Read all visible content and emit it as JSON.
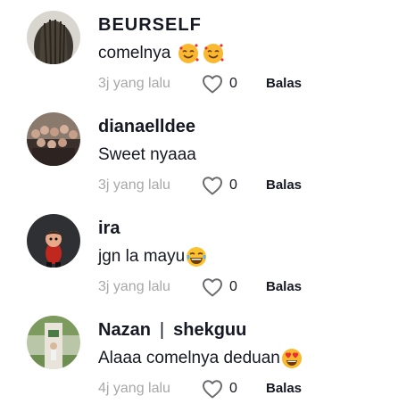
{
  "comments": [
    {
      "username": "BEURSELF",
      "text": "comelnya",
      "emojis": [
        "smiling-hearts-emoji",
        "smiling-hearts-emoji"
      ],
      "time": "3j yang lalu",
      "likes": "0",
      "reply_label": "Balas"
    },
    {
      "username": "dianaelldee",
      "text": "Sweet nyaaa",
      "emojis": [],
      "time": "3j yang lalu",
      "likes": "0",
      "reply_label": "Balas"
    },
    {
      "username": "ira",
      "text": "jgn la mayu",
      "emojis": [
        "tears-of-joy-emoji"
      ],
      "time": "3j yang lalu",
      "likes": "0",
      "reply_label": "Balas"
    },
    {
      "username": "Nazan",
      "username_separator": "|",
      "username_secondary": "shekguu",
      "text": "Alaaa comelnya deduan",
      "emojis": [
        "heart-eyes-emoji"
      ],
      "time": "4j yang lalu",
      "likes": "0",
      "reply_label": "Balas"
    }
  ],
  "icons": {
    "like": "heart-outline-icon"
  },
  "colors": {
    "text_primary": "#161823",
    "text_secondary": "#a8a8ab",
    "background": "#ffffff"
  }
}
